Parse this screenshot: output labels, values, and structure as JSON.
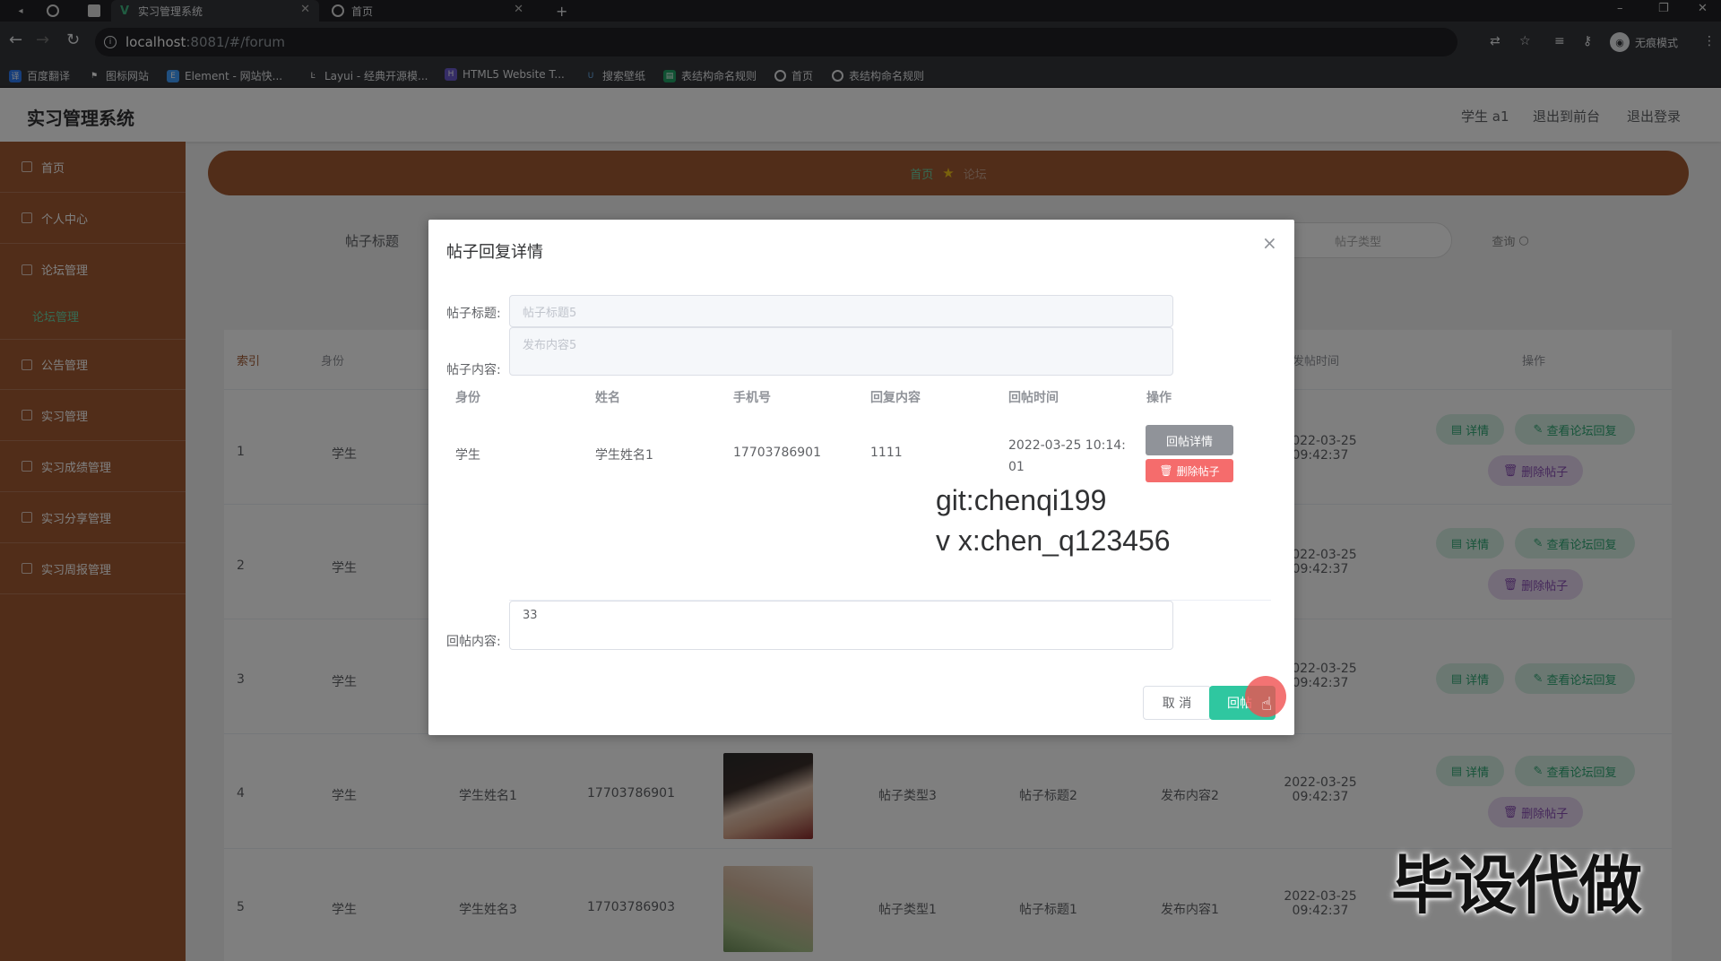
{
  "browser": {
    "tabs": [
      {
        "title": "",
        "icon": "speaker-icon"
      },
      {
        "title": "实习管理系统",
        "icon": "vue-icon",
        "active": true
      },
      {
        "title": "首页",
        "icon": "globe-icon"
      }
    ],
    "url_host": "localhost",
    "url_rest": ":8081/#/forum",
    "profile_label": "无痕模式",
    "bookmarks": [
      "百度翻译",
      "图标网站",
      "Element - 网站快...",
      "Layui - 经典开源模...",
      "HTML5 Website T...",
      "搜索壁纸",
      "表结构命名规则",
      "首页",
      "表结构命名规则"
    ]
  },
  "header": {
    "title": "实习管理系统",
    "user": "学生 a1",
    "to_front": "退出到前台",
    "logout": "退出登录"
  },
  "sidebar": {
    "items": [
      "首页",
      "个人中心",
      "论坛管理",
      "公告管理",
      "实习管理",
      "实习成绩管理",
      "实习分享管理",
      "实习周报管理"
    ],
    "sub_item": "论坛管理"
  },
  "breadcrumb": {
    "home": "首页",
    "current": "论坛"
  },
  "search": {
    "label": "帖子标题",
    "placeholder": "帖子类型",
    "button": "查询"
  },
  "table": {
    "headers": [
      "索引",
      "身份",
      "发帖时间",
      "操作"
    ],
    "rows": [
      {
        "index": "1",
        "identity": "学生",
        "name": "",
        "phone": "",
        "type": "",
        "title": "",
        "content": "",
        "time": "2022-03-25 09:42:37"
      },
      {
        "index": "2",
        "identity": "学生",
        "name": "",
        "phone": "",
        "type": "",
        "title": "",
        "content": "",
        "time": "2022-03-25 09:42:37"
      },
      {
        "index": "3",
        "identity": "学生",
        "name": "",
        "phone": "",
        "type": "",
        "title": "",
        "content": "",
        "time": "2022-03-25 09:42:37"
      },
      {
        "index": "4",
        "identity": "学生",
        "name": "学生姓名1",
        "phone": "17703786901",
        "type": "帖子类型3",
        "title": "帖子标题2",
        "content": "发布内容2",
        "time": "2022-03-25 09:42:37"
      },
      {
        "index": "5",
        "identity": "学生",
        "name": "学生姓名3",
        "phone": "17703786903",
        "type": "帖子类型1",
        "title": "帖子标题1",
        "content": "发布内容1",
        "time": "2022-03-25 09:42:37"
      }
    ],
    "btn_detail": "详情",
    "btn_view_reply": "查看论坛回复",
    "btn_delete": "删除帖子"
  },
  "dialog": {
    "title": "帖子回复详情",
    "close": "×",
    "title_label": "帖子标题:",
    "title_value": "帖子标题5",
    "content_label": "帖子内容:",
    "content_value": "发布内容5",
    "reply_headers": [
      "身份",
      "姓名",
      "手机号",
      "回复内容",
      "回帖时间",
      "操作"
    ],
    "reply_row": {
      "identity": "学生",
      "name": "学生姓名1",
      "phone": "17703786901",
      "content": "1111",
      "time": "2022-03-25 10:14:01"
    },
    "btn_reply_detail": "回帖详情",
    "btn_delete_post": "删除帖子",
    "watermark_line1": "git:chenqi199",
    "watermark_line2": "v x:chen_q123456",
    "reply_label": "回帖内容:",
    "reply_value": "33",
    "cancel": "取 消",
    "submit": "回帖"
  },
  "overlay_watermark": "毕设代做"
}
